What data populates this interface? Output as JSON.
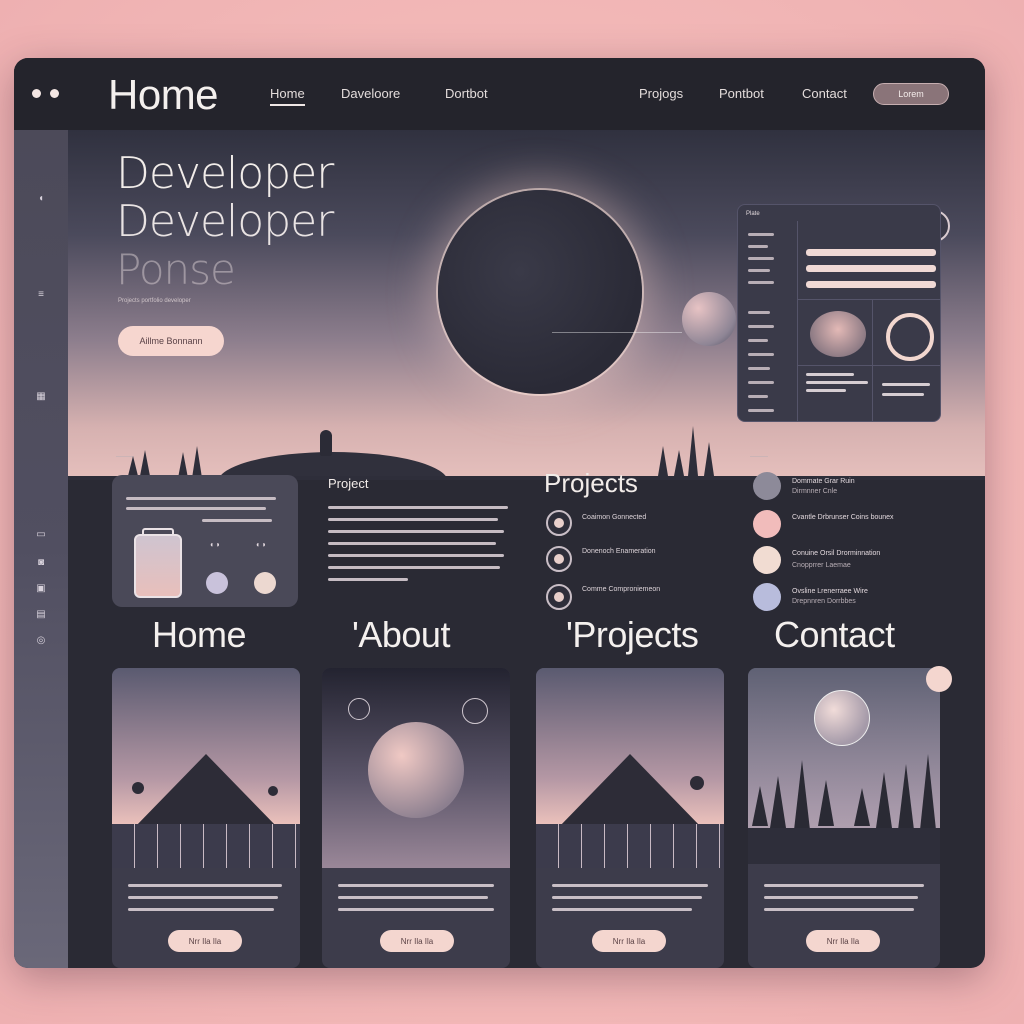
{
  "nav": {
    "brand": "Home",
    "links": [
      "Home",
      "Daveloore",
      "Dortbot",
      "Projogs",
      "Pontbot",
      "Contact"
    ],
    "cta": "Lorem"
  },
  "hero": {
    "title_line1": "Developer",
    "title_line2": "Developer",
    "title_line3": "Ponse",
    "subtitle": "Projects portfolio developer",
    "button": "Aillme Bonnann"
  },
  "dashboard": {
    "title": "Plate"
  },
  "sections": {
    "project_label": "Project",
    "projects_title": "Projects",
    "home": "Home",
    "about": "'About",
    "projects": "'Projects",
    "contact": "Contact"
  },
  "projects": [
    {
      "text": "Coaimon Gonnected"
    },
    {
      "text": "Donenoch Enameration"
    },
    {
      "text": "Comme Comproniemeon"
    }
  ],
  "contacts": [
    {
      "name": "Dommate Grar Ruin",
      "sub": "Dirmnner Cnle"
    },
    {
      "name": "Cvantle Drbrunser Coins bounex",
      "sub": ""
    },
    {
      "name": "Conuine Orsil Drorminnation",
      "sub": "Cnopprrer Laemae"
    },
    {
      "name": "Ovsline Lrenerraee Wire",
      "sub": "Drepnnren Dorrbbes"
    }
  ],
  "card_buttons": [
    "Nrr Ila Ila",
    "Nrr Ila Ila",
    "Nrr Ila Ila",
    "Nrr Ila Ila"
  ],
  "colors": {
    "background": "#f3b9b8",
    "window": "#2a2a34",
    "accent": "#f4d6cf",
    "text": "#f4f0ee"
  }
}
